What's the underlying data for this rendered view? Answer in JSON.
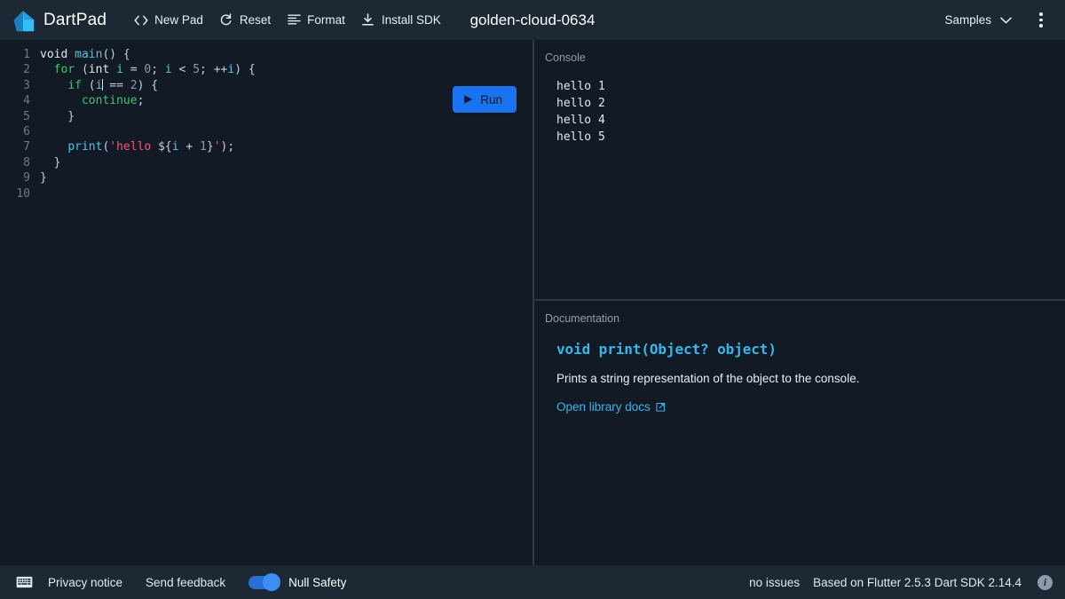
{
  "header": {
    "brand": "DartPad",
    "logo_icon": "dart-logo-icon",
    "buttons": [
      {
        "label": "New Pad",
        "icon": "code-brackets-icon"
      },
      {
        "label": "Reset",
        "icon": "refresh-icon"
      },
      {
        "label": "Format",
        "icon": "format-lines-icon"
      },
      {
        "label": "Install SDK",
        "icon": "download-icon"
      }
    ],
    "doc_title": "golden-cloud-0634",
    "samples_label": "Samples",
    "samples_chevron_icon": "chevron-down-icon",
    "more_menu_icon": "kebab-menu-icon"
  },
  "editor": {
    "run_label": "Run",
    "run_icon": "play-icon",
    "line_numbers": [
      "1",
      "2",
      "3",
      "4",
      "5",
      "6",
      "7",
      "8",
      "9",
      "10"
    ],
    "lines": [
      [
        {
          "t": "void",
          "c": "type"
        },
        {
          "t": " ",
          "c": "punct"
        },
        {
          "t": "main",
          "c": "fn"
        },
        {
          "t": "() {",
          "c": "punct"
        }
      ],
      [
        {
          "t": "  ",
          "c": "punct"
        },
        {
          "t": "for",
          "c": "kw"
        },
        {
          "t": " (",
          "c": "punct"
        },
        {
          "t": "int",
          "c": "type"
        },
        {
          "t": " ",
          "c": "punct"
        },
        {
          "t": "i",
          "c": "var"
        },
        {
          "t": " = ",
          "c": "op"
        },
        {
          "t": "0",
          "c": "num"
        },
        {
          "t": "; ",
          "c": "punct"
        },
        {
          "t": "i",
          "c": "var"
        },
        {
          "t": " < ",
          "c": "op"
        },
        {
          "t": "5",
          "c": "num"
        },
        {
          "t": "; ",
          "c": "punct"
        },
        {
          "t": "++",
          "c": "op"
        },
        {
          "t": "i",
          "c": "var"
        },
        {
          "t": ") {",
          "c": "punct"
        }
      ],
      [
        {
          "t": "    ",
          "c": "punct"
        },
        {
          "t": "if",
          "c": "kw"
        },
        {
          "t": " (",
          "c": "punct"
        },
        {
          "t": "i",
          "c": "var"
        },
        {
          "t": "|CARET|",
          "c": "caret"
        },
        {
          "t": " == ",
          "c": "op"
        },
        {
          "t": "2",
          "c": "num"
        },
        {
          "t": ") {",
          "c": "punct"
        }
      ],
      [
        {
          "t": "      ",
          "c": "punct"
        },
        {
          "t": "continue",
          "c": "kw"
        },
        {
          "t": ";",
          "c": "punct"
        }
      ],
      [
        {
          "t": "    }",
          "c": "punct"
        }
      ],
      [
        {
          "t": "",
          "c": "punct"
        }
      ],
      [
        {
          "t": "    ",
          "c": "punct"
        },
        {
          "t": "print",
          "c": "fn"
        },
        {
          "t": "(",
          "c": "punct"
        },
        {
          "t": "'hello ",
          "c": "str"
        },
        {
          "t": "${",
          "c": "punct"
        },
        {
          "t": "i",
          "c": "var"
        },
        {
          "t": " + ",
          "c": "op"
        },
        {
          "t": "1",
          "c": "num"
        },
        {
          "t": "}",
          "c": "punct"
        },
        {
          "t": "'",
          "c": "str"
        },
        {
          "t": ");",
          "c": "punct"
        }
      ],
      [
        {
          "t": "  }",
          "c": "punct"
        }
      ],
      [
        {
          "t": "}",
          "c": "punct"
        }
      ],
      [
        {
          "t": "",
          "c": "punct"
        }
      ]
    ]
  },
  "console": {
    "label": "Console",
    "lines": [
      "hello 1",
      "hello 2",
      "hello 4",
      "hello 5"
    ]
  },
  "documentation": {
    "label": "Documentation",
    "signature": "void print(Object? object)",
    "description": "Prints a string representation of the object to the console.",
    "link_label": "Open library docs",
    "link_icon": "external-link-icon"
  },
  "footer": {
    "keyboard_icon": "keyboard-icon",
    "privacy_label": "Privacy notice",
    "feedback_label": "Send feedback",
    "null_safety_label": "Null Safety",
    "null_safety_on": true,
    "issues_label": "no issues",
    "version_label": "Based on Flutter 2.5.3 Dart SDK 2.14.4",
    "info_icon": "info-icon"
  },
  "colors": {
    "header_bg": "#1c2834",
    "panel_bg": "#121a26",
    "divider": "#2b3b4d",
    "accent_blue": "#1a73f0",
    "link_cyan": "#35b8e8",
    "keyword_green": "#3ec46d",
    "string_pink": "#f2587f",
    "toggle_blue": "#3d8ef5"
  }
}
